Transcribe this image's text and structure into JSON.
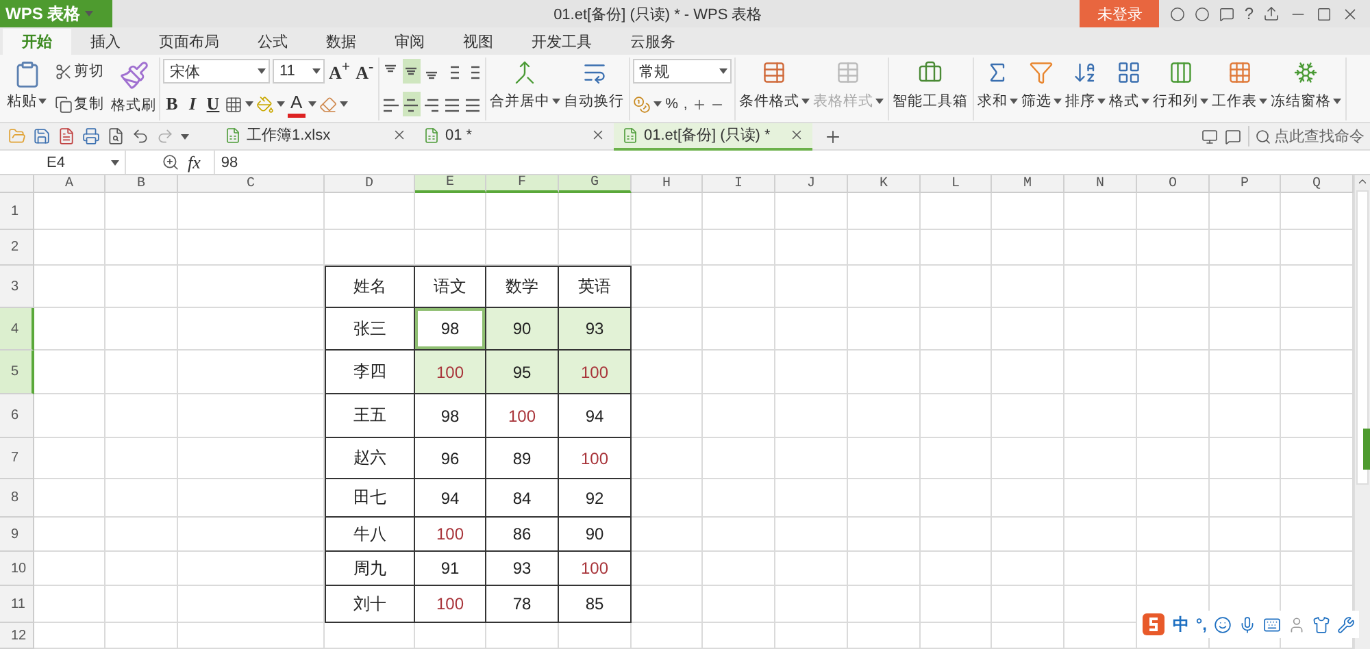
{
  "app": {
    "name": "WPS 表格"
  },
  "window": {
    "title": "01.et[备份] (只读) * - WPS 表格",
    "login": "未登录",
    "help": "?"
  },
  "menu": [
    {
      "label": "开始",
      "selected": true
    },
    {
      "label": "插入",
      "selected": false
    },
    {
      "label": "页面布局",
      "selected": false
    },
    {
      "label": "公式",
      "selected": false
    },
    {
      "label": "数据",
      "selected": false
    },
    {
      "label": "审阅",
      "selected": false
    },
    {
      "label": "视图",
      "selected": false
    },
    {
      "label": "开发工具",
      "selected": false
    },
    {
      "label": "云服务",
      "selected": false
    }
  ],
  "ribbon": {
    "clipboard": {
      "paste": "粘贴",
      "cut": "剪切",
      "copy": "复制",
      "painter": "格式刷"
    },
    "font": {
      "name": "宋体",
      "size": "11",
      "grow": "A$^{+}$",
      "shrink": "A$^{-}$",
      "styles": [
        "B",
        "I",
        "U"
      ],
      "color_label": "A"
    },
    "align": [
      {
        "selected": false
      },
      {
        "selected": true
      },
      {
        "selected": false
      },
      {
        "selected": false
      },
      {
        "selected": false
      },
      {
        "selected": false
      },
      {
        "selected": true
      },
      {
        "selected": false
      },
      {
        "selected": false
      },
      {
        "selected": false
      }
    ],
    "number": {
      "format": "常规",
      "percent": "%",
      "comma": ","
    },
    "groups": [
      [
        {
          "label": "合并居中",
          "dropdown": true,
          "disabled": false
        },
        {
          "label": "自动换行",
          "dropdown": false,
          "disabled": false
        }
      ],
      [
        {
          "label": "条件格式",
          "dropdown": true,
          "disabled": false
        },
        {
          "label": "表格样式",
          "dropdown": true,
          "disabled": true
        }
      ],
      [
        {
          "label": "智能工具箱",
          "dropdown": false,
          "disabled": false
        }
      ],
      [
        {
          "label": "求和",
          "dropdown": true,
          "disabled": false
        },
        {
          "label": "筛选",
          "dropdown": true,
          "disabled": false
        },
        {
          "label": "排序",
          "dropdown": true,
          "disabled": false
        },
        {
          "label": "格式",
          "dropdown": true,
          "disabled": false
        },
        {
          "label": "行和列",
          "dropdown": true,
          "disabled": false
        },
        {
          "label": "工作表",
          "dropdown": true,
          "disabled": false
        },
        {
          "label": "冻结窗格",
          "dropdown": true,
          "disabled": false
        }
      ]
    ]
  },
  "doc_tabs": [
    {
      "label": "工作簿1.xlsx",
      "selected": false
    },
    {
      "label": "01 *",
      "selected": false
    },
    {
      "label": "01.et[备份] (只读) *",
      "selected": true
    }
  ],
  "command_search": {
    "placeholder": "点此查找命令"
  },
  "formula_bar": {
    "cell": "E4",
    "fx": "fx",
    "value": "98"
  },
  "sheet": {
    "columns": [
      {
        "label": "A",
        "selected": false
      },
      {
        "label": "B",
        "selected": false
      },
      {
        "label": "C",
        "selected": false
      },
      {
        "label": "D",
        "selected": false
      },
      {
        "label": "E",
        "selected": true
      },
      {
        "label": "F",
        "selected": true
      },
      {
        "label": "G",
        "selected": true
      },
      {
        "label": "H",
        "selected": false
      },
      {
        "label": "I",
        "selected": false
      },
      {
        "label": "J",
        "selected": false
      },
      {
        "label": "K",
        "selected": false
      },
      {
        "label": "L",
        "selected": false
      },
      {
        "label": "M",
        "selected": false
      },
      {
        "label": "N",
        "selected": false
      },
      {
        "label": "O",
        "selected": false
      },
      {
        "label": "P",
        "selected": false
      },
      {
        "label": "Q",
        "selected": false
      }
    ],
    "rows": [
      {
        "label": "1",
        "selected": false
      },
      {
        "label": "2",
        "selected": false
      },
      {
        "label": "3",
        "selected": false
      },
      {
        "label": "4",
        "selected": true
      },
      {
        "label": "5",
        "selected": true
      },
      {
        "label": "6",
        "selected": false
      },
      {
        "label": "7",
        "selected": false
      },
      {
        "label": "8",
        "selected": false
      },
      {
        "label": "9",
        "selected": false
      },
      {
        "label": "10",
        "selected": false
      },
      {
        "label": "11",
        "selected": false
      },
      {
        "label": "12",
        "selected": false
      }
    ]
  },
  "table": {
    "header": [
      "姓名",
      "语文",
      "数学",
      "英语"
    ],
    "rows": [
      {
        "name": "张三",
        "scores": [
          {
            "value": "98",
            "selected": true,
            "active": true,
            "highlighted": false
          },
          {
            "value": "90",
            "selected": true,
            "active": false,
            "highlighted": false
          },
          {
            "value": "93",
            "selected": true,
            "active": false,
            "highlighted": false
          }
        ]
      },
      {
        "name": "李四",
        "scores": [
          {
            "value": "100",
            "selected": true,
            "active": false,
            "highlighted": true
          },
          {
            "value": "95",
            "selected": true,
            "active": false,
            "highlighted": false
          },
          {
            "value": "100",
            "selected": true,
            "active": false,
            "highlighted": true
          }
        ]
      },
      {
        "name": "王五",
        "scores": [
          {
            "value": "98",
            "selected": false,
            "active": false,
            "highlighted": false
          },
          {
            "value": "100",
            "selected": false,
            "active": false,
            "highlighted": true
          },
          {
            "value": "94",
            "selected": false,
            "active": false,
            "highlighted": false
          }
        ]
      },
      {
        "name": "赵六",
        "scores": [
          {
            "value": "96",
            "selected": false,
            "active": false,
            "highlighted": false
          },
          {
            "value": "89",
            "selected": false,
            "active": false,
            "highlighted": false
          },
          {
            "value": "100",
            "selected": false,
            "active": false,
            "highlighted": true
          }
        ]
      },
      {
        "name": "田七",
        "scores": [
          {
            "value": "94",
            "selected": false,
            "active": false,
            "highlighted": false
          },
          {
            "value": "84",
            "selected": false,
            "active": false,
            "highlighted": false
          },
          {
            "value": "92",
            "selected": false,
            "active": false,
            "highlighted": false
          }
        ]
      },
      {
        "name": "牛八",
        "scores": [
          {
            "value": "100",
            "selected": false,
            "active": false,
            "highlighted": true
          },
          {
            "value": "86",
            "selected": false,
            "active": false,
            "highlighted": false
          },
          {
            "value": "90",
            "selected": false,
            "active": false,
            "highlighted": false
          }
        ]
      },
      {
        "name": "周九",
        "scores": [
          {
            "value": "91",
            "selected": false,
            "active": false,
            "highlighted": false
          },
          {
            "value": "93",
            "selected": false,
            "active": false,
            "highlighted": false
          },
          {
            "value": "100",
            "selected": false,
            "active": false,
            "highlighted": true
          }
        ]
      },
      {
        "name": "刘十",
        "scores": [
          {
            "value": "100",
            "selected": false,
            "active": false,
            "highlighted": true
          },
          {
            "value": "78",
            "selected": false,
            "active": false,
            "highlighted": false
          },
          {
            "value": "85",
            "selected": false,
            "active": false,
            "highlighted": false
          }
        ]
      }
    ]
  },
  "ime": {
    "mode": "中",
    "punct": "°,"
  }
}
